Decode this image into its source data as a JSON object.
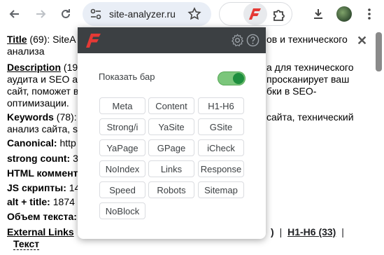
{
  "browser": {
    "url": "site-analyzer.ru"
  },
  "page": {
    "lines": [
      {
        "label": "Title",
        "text": " (69): SiteA"
      },
      {
        "label": "",
        "text": "анализа"
      },
      {
        "label": "Description",
        "text": " (19"
      },
      {
        "label": "",
        "text": "аудита и SEO а"
      },
      {
        "label": "",
        "text": "сайт, поможет в"
      },
      {
        "label": "",
        "text": "оптимизации."
      },
      {
        "label": "Keywords",
        "text": " (78):"
      },
      {
        "label": "",
        "text": "анализ сайта, s"
      },
      {
        "label": "Canonical:",
        "text": " http"
      },
      {
        "label": "strong count:",
        "text": " 3"
      },
      {
        "label": "HTML коммент",
        "text": ""
      },
      {
        "label": "JS скрипты:",
        "text": " 14"
      },
      {
        "label": "alt + title:",
        "text": " 1874"
      },
      {
        "label": "Объем текста:",
        "text": ""
      },
      {
        "label": "External Links",
        "text": ""
      }
    ],
    "right_fragments": {
      "title_tail": "ов и технического",
      "desc_tail1": "а для технического",
      "desc_tail2": "просканирует ваш",
      "desc_tail3": "бки в SEO-",
      "kw_tail": "сайта, технический"
    },
    "bottom_links": {
      "paren": ")",
      "sep1": "|",
      "h1h6": "H1-H6 (33)",
      "sep2": "|"
    },
    "last_link": "Текст",
    "close_symbol": "✕"
  },
  "popup": {
    "show_bar_label": "Показать бар",
    "show_bar_enabled": true,
    "buttons": [
      "Meta",
      "Content",
      "H1-H6",
      "Strong/i",
      "YaSite",
      "GSite",
      "YaPage",
      "GPage",
      "iCheck",
      "NoIndex",
      "Links",
      "Response",
      "Speed",
      "Robots",
      "Sitemap",
      "NoBlock"
    ]
  },
  "colors": {
    "popup_header": "#3c4043",
    "brand_red": "#e53935",
    "toggle_on": "#1e8e3e"
  }
}
